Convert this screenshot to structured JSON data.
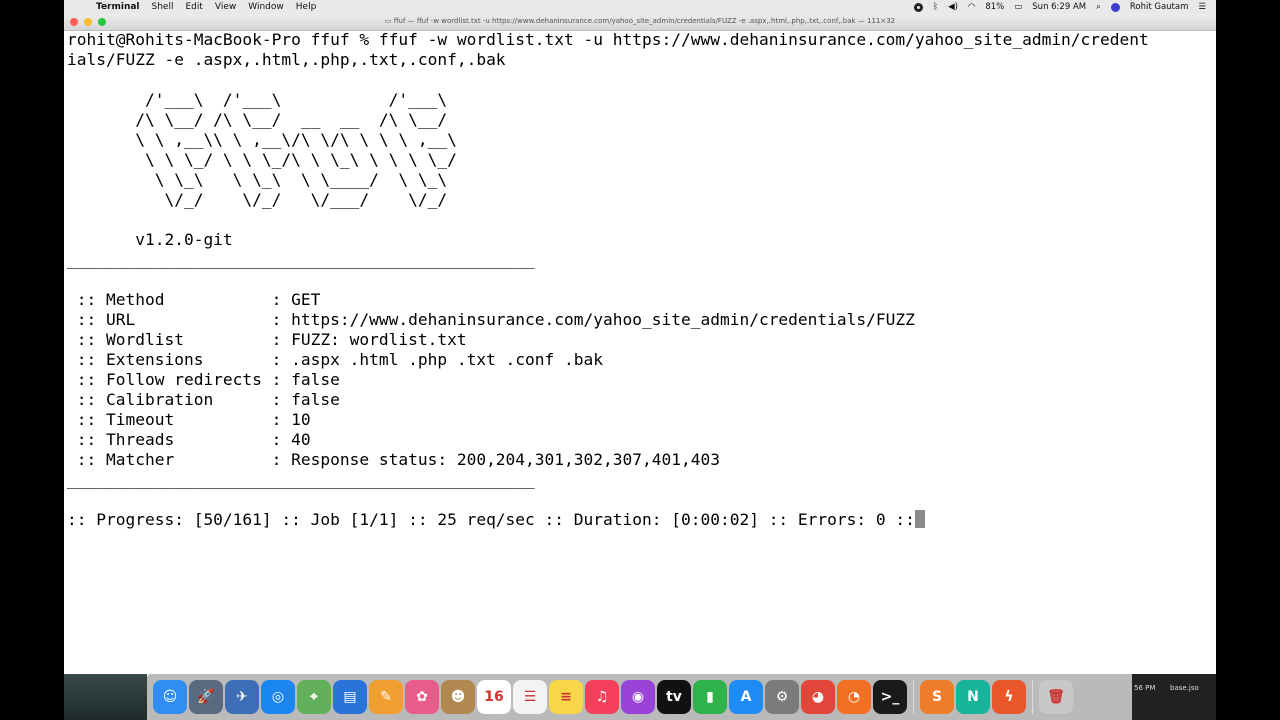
{
  "menubar": {
    "app": "Terminal",
    "items": [
      "Shell",
      "Edit",
      "View",
      "Window",
      "Help"
    ],
    "battery": "81%",
    "clock": "Sun 6:29 AM",
    "user": "Rohit Gautam"
  },
  "window": {
    "title": "ffuf — ffuf -w wordlist.txt -u https://www.dehaninsurance.com/yahoo_site_admin/credentials/FUZZ -e .aspx,.html,.php,.txt,.conf,.bak — 111×32"
  },
  "terminal": {
    "lines": [
      "rohit@Rohits-MacBook-Pro ffuf % ffuf -w wordlist.txt -u https://www.dehaninsurance.com/yahoo_site_admin/credent",
      "ials/FUZZ -e .aspx,.html,.php,.txt,.conf,.bak",
      "",
      "        /'___\\  /'___\\           /'___\\",
      "       /\\ \\__/ /\\ \\__/  __  __  /\\ \\__/",
      "       \\ \\ ,__\\\\ \\ ,__\\/\\ \\/\\ \\ \\ \\ ,__\\",
      "        \\ \\ \\_/ \\ \\ \\_/\\ \\ \\_\\ \\ \\ \\ \\_/",
      "         \\ \\_\\   \\ \\_\\  \\ \\____/  \\ \\_\\",
      "          \\/_/    \\/_/   \\/___/    \\/_/",
      "",
      "       v1.2.0-git",
      "________________________________________________",
      "",
      " :: Method           : GET",
      " :: URL              : https://www.dehaninsurance.com/yahoo_site_admin/credentials/FUZZ",
      " :: Wordlist         : FUZZ: wordlist.txt",
      " :: Extensions       : .aspx .html .php .txt .conf .bak",
      " :: Follow redirects : false",
      " :: Calibration      : false",
      " :: Timeout          : 10",
      " :: Threads          : 40",
      " :: Matcher          : Response status: 200,204,301,302,307,401,403",
      "________________________________________________",
      "",
      ":: Progress: [50/161] :: Job [1/1] :: 25 req/sec :: Duration: [0:00:02] :: Errors: 0 ::"
    ]
  },
  "dock": {
    "items": [
      {
        "name": "finder-icon",
        "glyph": "☺",
        "color": "#2f8ef0"
      },
      {
        "name": "launchpad-icon",
        "glyph": "🚀",
        "color": "#5a6a80"
      },
      {
        "name": "preview-icon",
        "glyph": "✈",
        "color": "#3d6fb8"
      },
      {
        "name": "safari-icon",
        "glyph": "◎",
        "color": "#1b86f0"
      },
      {
        "name": "maps-icon",
        "glyph": "⌖",
        "color": "#62b05a"
      },
      {
        "name": "keynote-icon",
        "glyph": "▤",
        "color": "#2a74d8"
      },
      {
        "name": "pages-icon",
        "glyph": "✎",
        "color": "#f0a030"
      },
      {
        "name": "photos-icon",
        "glyph": "✿",
        "color": "#e85c8a"
      },
      {
        "name": "contacts-icon",
        "glyph": "☻",
        "color": "#b08850"
      },
      {
        "name": "calendar-icon",
        "glyph": "16",
        "color": "#ffffff"
      },
      {
        "name": "reminders-icon",
        "glyph": "☰",
        "color": "#f3f3f3"
      },
      {
        "name": "notes-icon",
        "glyph": "≡",
        "color": "#f7d64a"
      },
      {
        "name": "music-icon",
        "glyph": "♫",
        "color": "#f4405a"
      },
      {
        "name": "podcasts-icon",
        "glyph": "◉",
        "color": "#9a43d8"
      },
      {
        "name": "appletv-icon",
        "glyph": "tv",
        "color": "#111111"
      },
      {
        "name": "numbers-icon",
        "glyph": "▮",
        "color": "#2fb24a"
      },
      {
        "name": "appstore-icon",
        "glyph": "A",
        "color": "#1d8cf5"
      },
      {
        "name": "system-preferences-icon",
        "glyph": "⚙",
        "color": "#7b7b7b"
      },
      {
        "name": "chrome-icon",
        "glyph": "◕",
        "color": "#e2463a"
      },
      {
        "name": "firefox-icon",
        "glyph": "◔",
        "color": "#f27024"
      },
      {
        "name": "terminal-icon",
        "glyph": ">_",
        "color": "#1a1a1a"
      },
      {
        "name": "sublime-icon",
        "glyph": "S",
        "color": "#ef7c2a"
      },
      {
        "name": "webstorm-icon",
        "glyph": "N",
        "color": "#17b39a"
      },
      {
        "name": "burp-icon",
        "glyph": "ϟ",
        "color": "#e8562a"
      },
      {
        "name": "trash-icon",
        "glyph": "🗑",
        "color": "#c8c8c8"
      }
    ]
  },
  "desktop": {
    "file_label": "base.jso",
    "time_fragment": "56 PM"
  }
}
